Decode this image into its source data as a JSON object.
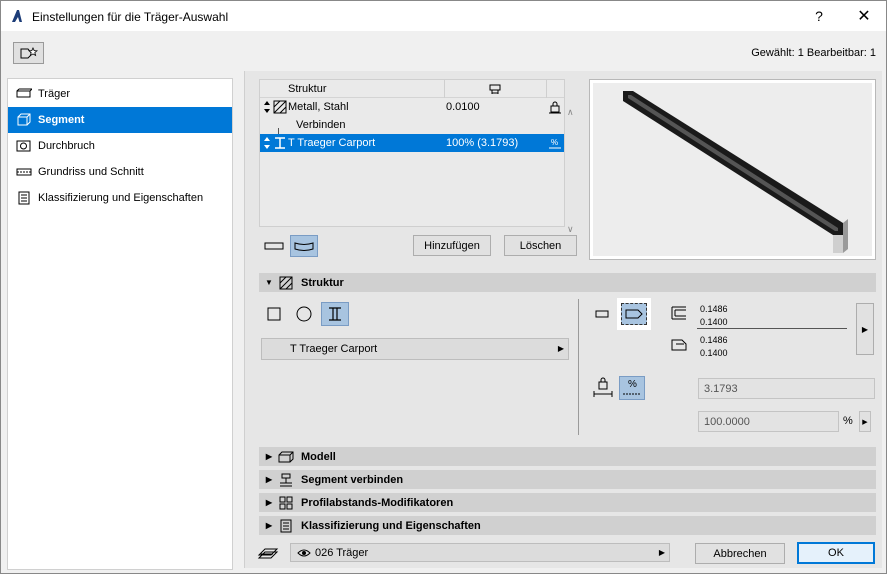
{
  "window": {
    "title": "Einstellungen für die Träger-Auswahl",
    "help_label": "?",
    "close_label": "✕"
  },
  "toolbar": {
    "selected_info": "Gewählt: 1 Bearbeitbar: 1"
  },
  "sidebar": {
    "items": [
      {
        "label": "Träger",
        "icon": "beam-icon",
        "active": false
      },
      {
        "label": "Segment",
        "icon": "segment-icon",
        "active": true
      },
      {
        "label": "Durchbruch",
        "icon": "opening-icon",
        "active": false
      },
      {
        "label": "Grundriss und Schnitt",
        "icon": "floorplan-icon",
        "active": false
      },
      {
        "label": "Klassifizierung und Eigenschaften",
        "icon": "classification-icon",
        "active": false
      }
    ]
  },
  "structure_table": {
    "header_name": "Struktur",
    "rows": [
      {
        "name": "Metall, Stahl",
        "value": "0.0100",
        "selected": false
      },
      {
        "name": "Verbinden",
        "value": "",
        "selected": false
      },
      {
        "name": "T Traeger Carport",
        "value": "100% (3.1793)",
        "selected": true
      }
    ],
    "scroll_up": "∧",
    "scroll_down": "∨",
    "add_label": "Hinzufügen",
    "delete_label": "Löschen"
  },
  "sections": {
    "struktur": "Struktur",
    "modell": "Modell",
    "segment_verbinden": "Segment verbinden",
    "profil_modifikatoren": "Profilabstands-Modifikatoren",
    "klassifizierung": "Klassifizierung und Eigenschaften"
  },
  "struktur_body": {
    "profile_name": "T Traeger Carport",
    "dim_top_1": "0.1486",
    "dim_top_2": "0.1400",
    "dim_bot_1": "0.1486",
    "dim_bot_2": "0.1400",
    "length_value": "3.1793",
    "percent_value": "100.0000",
    "percent_unit": "%",
    "percent_symbol": "%"
  },
  "footer": {
    "layer": "026 Träger",
    "cancel_label": "Abbrechen",
    "ok_label": "OK"
  },
  "colors": {
    "accent": "#0078d7",
    "active_tool": "#a8c4e0"
  }
}
